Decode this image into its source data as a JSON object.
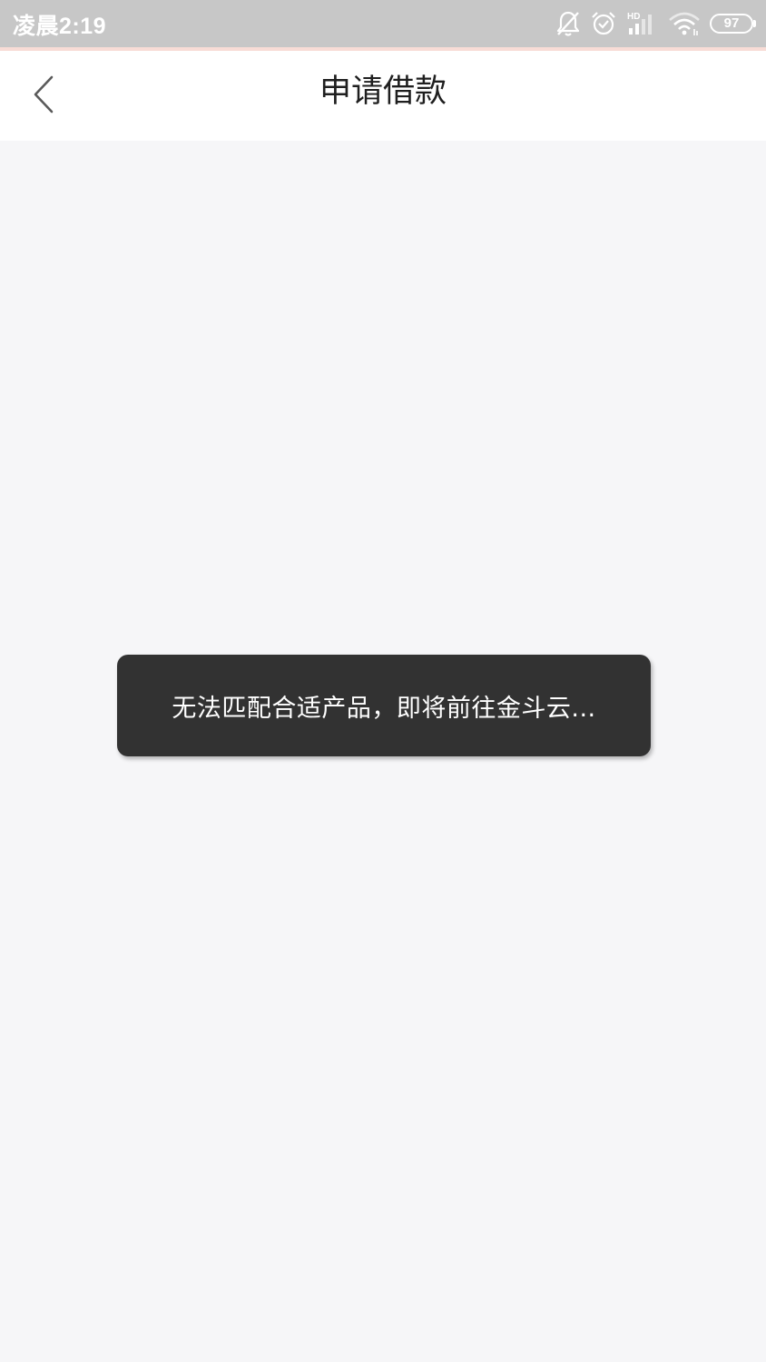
{
  "status_bar": {
    "time": "凌晨2:19",
    "network_label": "HD",
    "battery_level": "97",
    "icons": [
      "bell-off-icon",
      "alarm-icon",
      "hd-signal-icon",
      "wifi-icon",
      "battery-icon"
    ]
  },
  "nav_bar": {
    "title": "申请借款",
    "back_icon": "chevron-left-icon"
  },
  "toast": {
    "message": "无法匹配合适产品，即将前往金斗云..."
  },
  "colors": {
    "status_bar_bg": "#c7c7c7",
    "nav_bg": "#ffffff",
    "page_bg": "#f6f6f8",
    "toast_bg": "#323232",
    "toast_text": "#ffffff",
    "accent_line": "#f8dcd6"
  }
}
